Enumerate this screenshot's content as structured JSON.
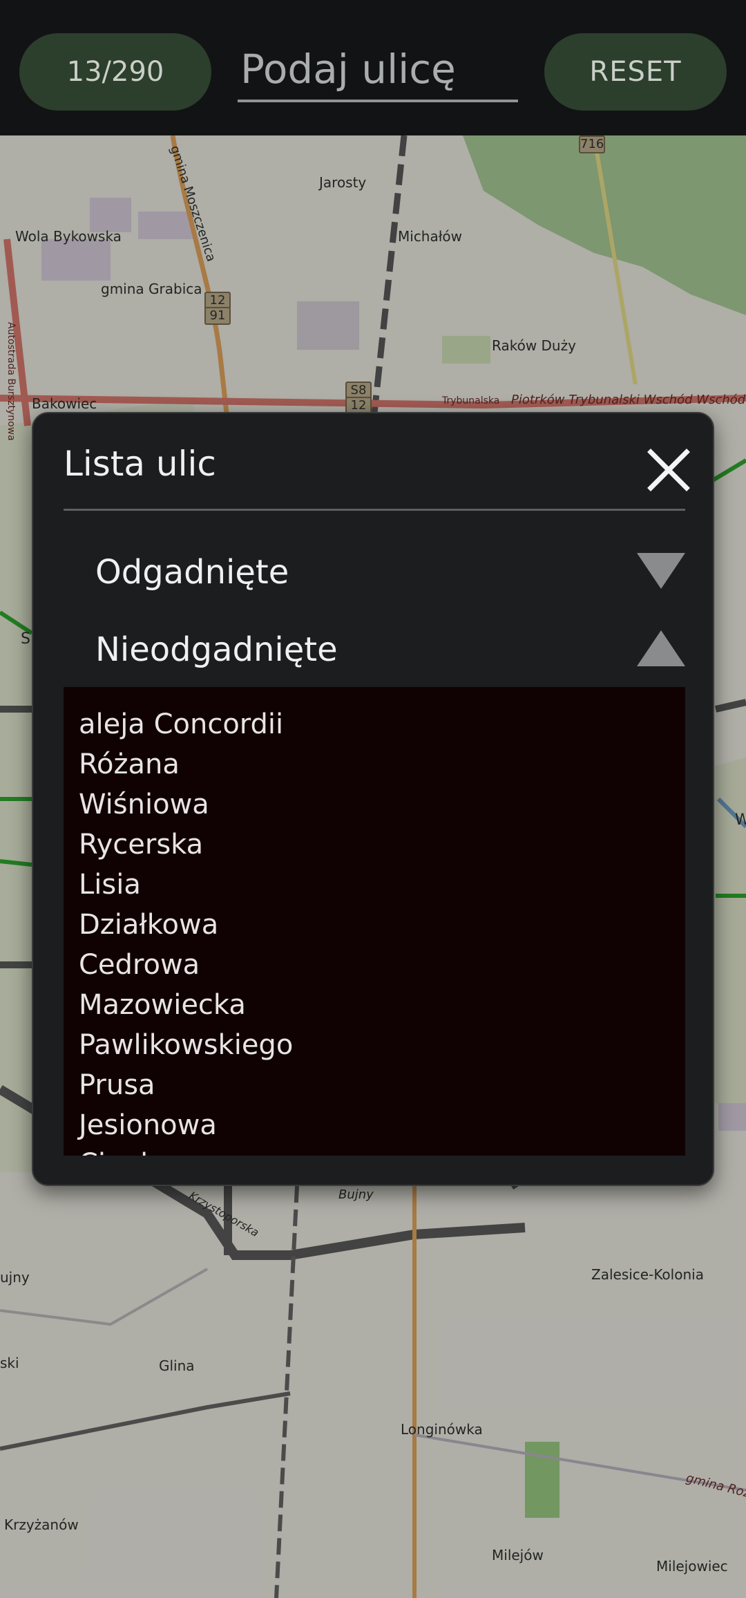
{
  "topbar": {
    "counter": "13/290",
    "search_placeholder": "Podaj ulicę",
    "reset_label": "RESET"
  },
  "map": {
    "labels": {
      "jarosty": "Jarosty",
      "wola_bykowska": "Wola Bykowska",
      "gmina_moszczenica": "gmina Moszczenica",
      "michalow": "Michałów",
      "gmina_grabica": "gmina Grabica",
      "rakow_duzy": "Raków Duży",
      "bakowiec": "Bakowiec",
      "autostrada": "Autostrada Bursztynowa",
      "trybunalska": "Trybunalska",
      "piotrkow_wschod": "Piotrków Trybunalski Wschód Wschód",
      "bujny": "Bujny",
      "krzystoporska": "Krzystoporska",
      "zalesice_kolonia": "Zalesice-Kolonia",
      "ujny": "ujny",
      "ski": "ski",
      "glina": "Glina",
      "longinowka": "Longinówka",
      "krzyzanow": "Krzyżanów",
      "milejow": "Milejów",
      "milejowiec": "Milejowiec",
      "gmina_roz": "gmina Roz",
      "s_left": "S",
      "w_right": "W"
    },
    "shields": {
      "r716": "716",
      "r12_91a": "12",
      "r12_91b": "91",
      "s8a": "S8",
      "s8b": "12"
    }
  },
  "dialog": {
    "title": "Lista ulic",
    "sections": {
      "guessed": "Odgadnięte",
      "unguessed": "Nieodgadnięte"
    },
    "streets": [
      "aleja Concordii",
      "Różana",
      "Wiśniowa",
      "Rycerska",
      "Lisia",
      "Działkowa",
      "Cedrowa",
      "Mazowiecka",
      "Pawlikowskiego",
      "Prusa",
      "Jesionowa",
      "Ciepła"
    ]
  }
}
